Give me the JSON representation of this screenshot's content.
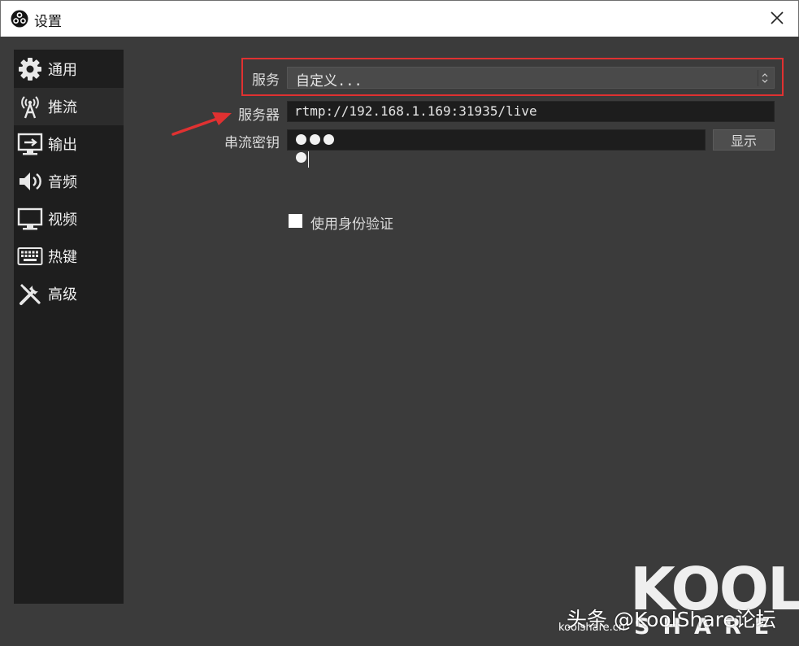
{
  "window": {
    "title": "设置"
  },
  "sidebar": {
    "items": [
      {
        "label": "通用",
        "icon": "gear-icon"
      },
      {
        "label": "推流",
        "icon": "broadcast-antenna-icon",
        "active": true
      },
      {
        "label": "输出",
        "icon": "output-monitor-icon"
      },
      {
        "label": "音频",
        "icon": "speaker-icon"
      },
      {
        "label": "视频",
        "icon": "monitor-icon"
      },
      {
        "label": "热键",
        "icon": "keyboard-icon"
      },
      {
        "label": "高级",
        "icon": "tools-icon"
      }
    ]
  },
  "form": {
    "service_label": "服务",
    "service_value": "自定义...",
    "server_label": "服务器",
    "server_value": "rtmp://192.168.1.169:31935/live",
    "stream_key_label": "串流密钥",
    "stream_key_masked_dots": 4,
    "show_button": "显示",
    "auth_checkbox_label": "使用身份验证",
    "auth_checked": false
  },
  "annotations": {
    "highlight_color": "#e03131",
    "arrow_color": "#e03131"
  },
  "watermark": {
    "logo_text": "KOOL",
    "logo_subtext": "SHARE",
    "site": "koolshare.cn",
    "toutiao": "头条 @KoolShare论坛"
  },
  "colors": {
    "background": "#3b3b3b",
    "sidebar": "#1e1e1e",
    "field": "#1d1d1d"
  }
}
